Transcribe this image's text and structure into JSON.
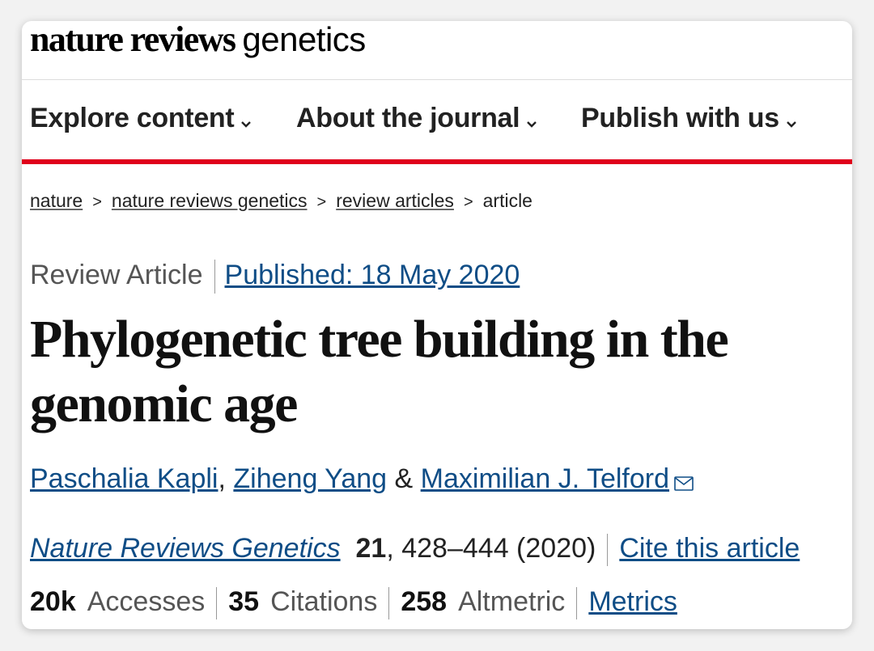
{
  "header": {
    "logo_bold": "nature reviews",
    "logo_light": "genetics"
  },
  "nav": {
    "items": [
      {
        "label": "Explore content",
        "icon": "chevron-down-icon"
      },
      {
        "label": "About the journal",
        "icon": "chevron-down-icon"
      },
      {
        "label": "Publish with us",
        "icon": "chevron-down-icon"
      }
    ],
    "accent_color": "#e0001b"
  },
  "breadcrumb": {
    "items": [
      "nature",
      "nature reviews genetics",
      "review articles"
    ],
    "current": "article",
    "separator": ">"
  },
  "article": {
    "type": "Review Article",
    "published": "Published: 18 May 2020",
    "title": "Phylogenetic tree building in the genomic age",
    "authors": [
      {
        "name": "Paschalia Kapli",
        "after": ", "
      },
      {
        "name": "Ziheng Yang",
        "after": " & "
      },
      {
        "name": "Maximilian J. Telford",
        "after": ""
      }
    ],
    "corresponding_icon": "mail-icon",
    "citation": {
      "journal": "Nature Reviews Genetics",
      "volume": "21",
      "pages_year": ", 428–444 (2020)",
      "cite_link": "Cite this article"
    },
    "metrics": {
      "accesses_value": "20k",
      "accesses_label": "Accesses",
      "citations_value": "35",
      "citations_label": "Citations",
      "altmetric_value": "258",
      "altmetric_label": "Altmetric",
      "metrics_link": "Metrics"
    },
    "link_color": "#0f4d86"
  }
}
